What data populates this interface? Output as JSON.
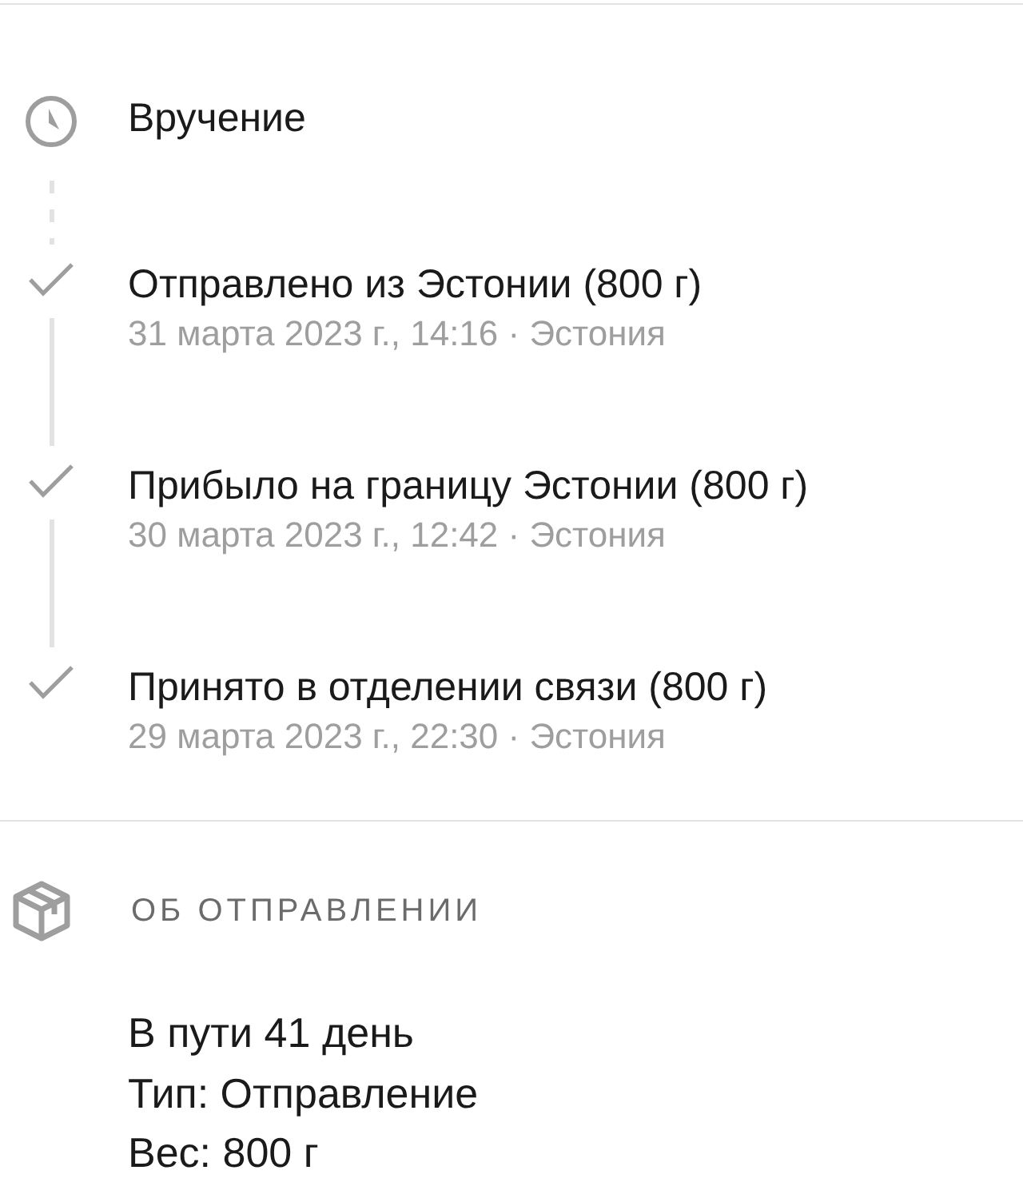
{
  "events": [
    {
      "kind": "pending",
      "title": "Вручение"
    },
    {
      "kind": "done",
      "title": "Отправлено из Эстонии (800 г)",
      "subtitle": "31 марта 2023 г., 14:16 · Эстония"
    },
    {
      "kind": "done",
      "title": "Прибыло на границу Эстонии (800 г)",
      "subtitle": "30 марта 2023 г., 12:42 · Эстония"
    },
    {
      "kind": "done",
      "title": "Принято в отделении связи (800 г)",
      "subtitle": "29 марта 2023 г., 22:30 · Эстония"
    }
  ],
  "details": {
    "heading": "ОБ ОТПРАВЛЕНИИ",
    "lines": [
      "В пути 41 день",
      "Тип: Отправление",
      "Вес: 800 г"
    ]
  }
}
